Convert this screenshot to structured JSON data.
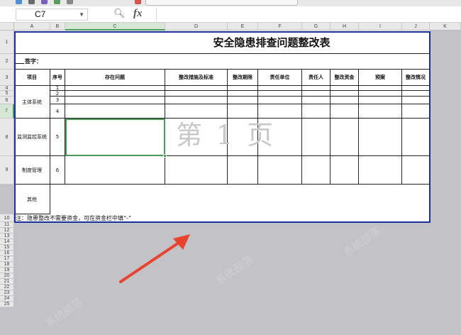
{
  "formula_bar": {
    "cell_ref": "C7",
    "fx_label": "fx",
    "zoom_icon": "magnify-icon"
  },
  "columns": [
    "A",
    "B",
    "C",
    "D",
    "E",
    "F",
    "G",
    "H",
    "I",
    "J",
    "K"
  ],
  "active_column": "C",
  "rows_numbers": [
    "1",
    "2",
    "3",
    "4",
    "5",
    "6",
    "7",
    "8",
    "9",
    "10",
    "11",
    "12",
    "13",
    "14",
    "15",
    "16",
    "17",
    "18",
    "19",
    "20",
    "21",
    "22",
    "23",
    "24",
    "25"
  ],
  "active_row": "7",
  "sheet": {
    "title": "安全隐患排查问题整改表",
    "sign_label": "签字：",
    "headers": [
      "项目",
      "序号",
      "存在问题",
      "整改措施及标准",
      "整改期限",
      "责任单位",
      "责任人",
      "整改资金",
      "预案",
      "整改情况"
    ],
    "rows": [
      {
        "project": "",
        "no": "1"
      },
      {
        "project": "",
        "no": "2"
      },
      {
        "project": "主体系统",
        "no": "3"
      },
      {
        "project": "监测监控系统",
        "no": "4"
      },
      {
        "project": "制度管理",
        "no": "5"
      },
      {
        "project": "其他",
        "no": "6"
      }
    ],
    "note": "注：隐患整改不需要资金，可在资金栏中填“-”",
    "page_watermark": "第 1 页"
  },
  "colors": {
    "page_border": "#1c2f9a",
    "selection": "#4a9a58",
    "background": "#c3c3c7",
    "arrow": "#e8432e"
  }
}
